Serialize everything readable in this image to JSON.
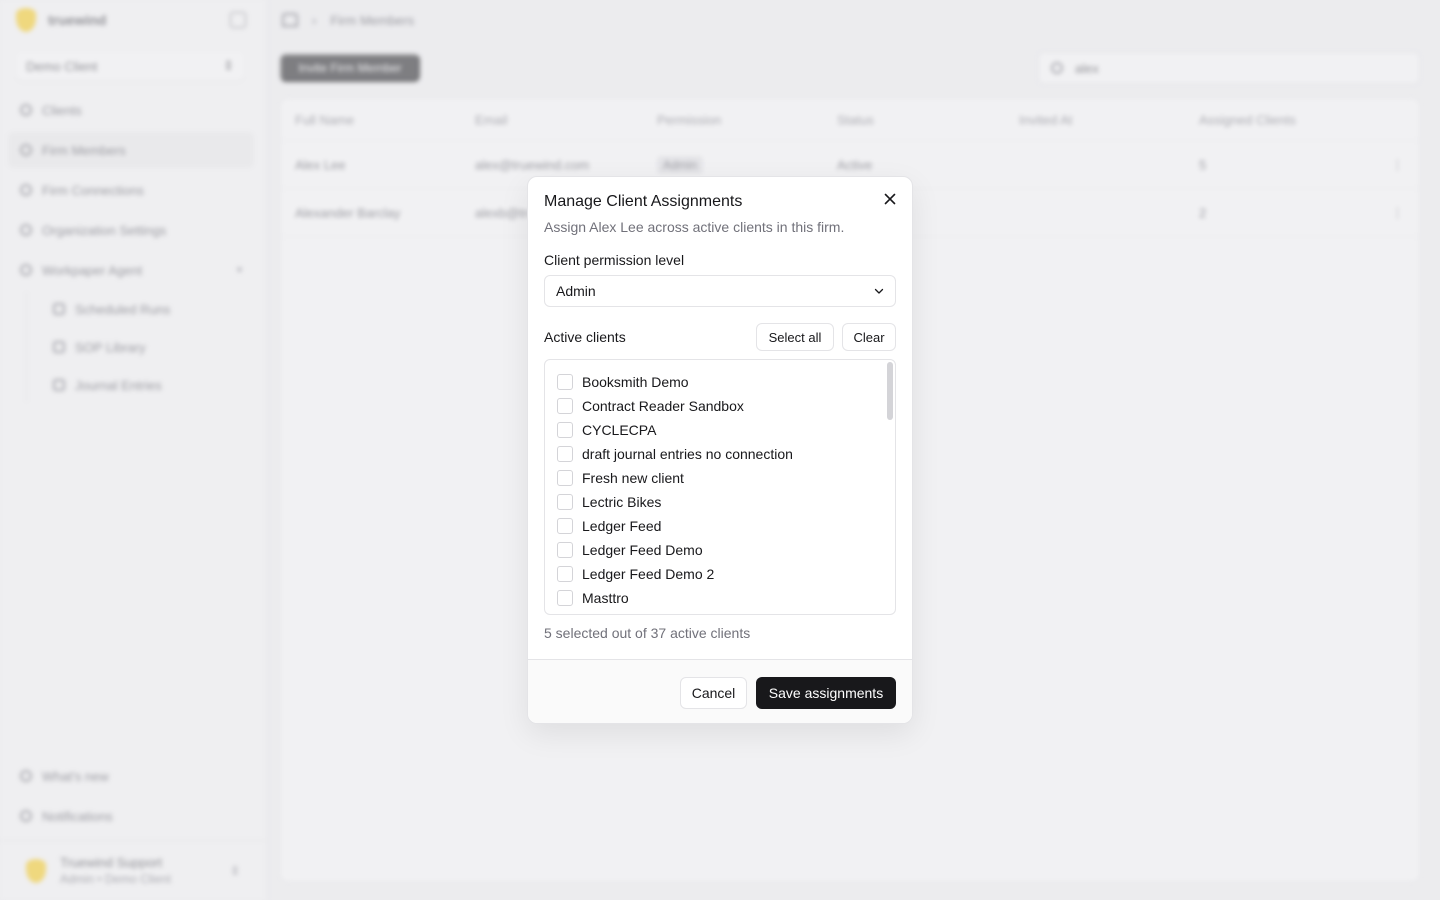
{
  "sidebar": {
    "brand": "truewind",
    "client_switcher": "Demo Client",
    "nav": [
      {
        "label": "Clients",
        "icon": "building-icon"
      },
      {
        "label": "Firm Members",
        "icon": "user-icon",
        "active": true
      },
      {
        "label": "Firm Connections",
        "icon": "link-icon"
      },
      {
        "label": "Organization Settings",
        "icon": "gear-icon"
      },
      {
        "label": "Workpaper Agent",
        "icon": "wrench-icon",
        "expanded": true
      }
    ],
    "subnav": [
      {
        "label": "Scheduled Runs",
        "icon": "calendar-icon"
      },
      {
        "label": "SOP Library",
        "icon": "book-icon"
      },
      {
        "label": "Journal Entries",
        "icon": "journal-icon"
      }
    ],
    "bottom": [
      {
        "label": "What's new",
        "icon": "sparkle-icon"
      },
      {
        "label": "Notifications",
        "icon": "bell-icon"
      }
    ],
    "user": {
      "name": "Truewind Support",
      "role": "Admin • Demo Client"
    }
  },
  "main": {
    "breadcrumb": "Firm Members",
    "invite_button": "Invite Firm Member",
    "search_value": "alex",
    "table": {
      "headers": [
        "Full Name",
        "Email",
        "Permission",
        "Status",
        "Invited At",
        "Assigned Clients"
      ],
      "rows": [
        {
          "name": "Alex Lee",
          "email": "alex@truewind.com",
          "permission": "Admin",
          "status": "Active",
          "invited": "",
          "assigned": "5",
          "more": "⋮"
        },
        {
          "name": "Alexander Barclay",
          "email": "alexb@truewind.com",
          "permission": "",
          "status": "",
          "invited": "",
          "assigned": "2",
          "more": "⋮"
        }
      ]
    }
  },
  "dialog": {
    "title": "Manage Client Assignments",
    "description": "Assign Alex Lee across active clients in this firm.",
    "permission_label": "Client permission level",
    "permission_value": "Admin",
    "active_clients_label": "Active clients",
    "select_all": "Select all",
    "clear": "Clear",
    "clients": [
      "Booksmith Demo",
      "Contract Reader Sandbox",
      "CYCLECPA",
      "draft journal entries no connection",
      "Fresh new client",
      "Lectric Bikes",
      "Ledger Feed",
      "Ledger Feed Demo",
      "Ledger Feed Demo 2",
      "Masttro"
    ],
    "summary": "5 selected out of 37 active clients",
    "cancel": "Cancel",
    "save": "Save assignments"
  }
}
